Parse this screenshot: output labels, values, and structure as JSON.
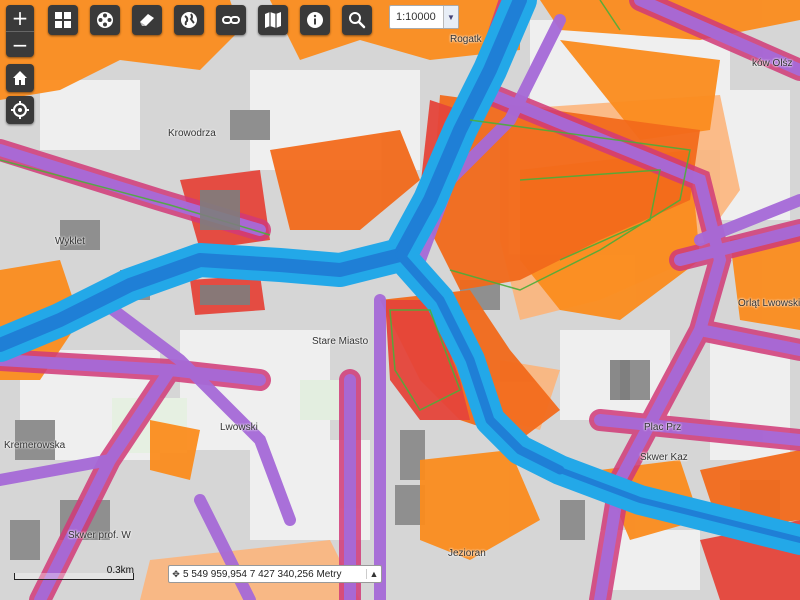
{
  "toolbar": {
    "zoom_in": "+",
    "zoom_out": "−",
    "buttons": [
      {
        "name": "layers-grid-icon"
      },
      {
        "name": "film-reel-icon"
      },
      {
        "name": "eraser-icon"
      },
      {
        "name": "globe-icon"
      },
      {
        "name": "link-icon"
      },
      {
        "name": "map-icon"
      },
      {
        "name": "info-icon"
      },
      {
        "name": "search-icon"
      }
    ],
    "side_buttons": [
      {
        "name": "home-icon"
      },
      {
        "name": "locate-icon"
      }
    ]
  },
  "scale_select": {
    "value": "1:10000"
  },
  "scale_bar": {
    "label": "0.3km"
  },
  "coordinates": {
    "text": "5 549 959,954 7 427 340,256 Metry"
  },
  "map_labels": {
    "krowodrza": "Krowodrza",
    "stare_miasto": "Stare Miasto",
    "rogatki": "Rogatk",
    "krakow_olsz": "ków Olśz",
    "wyklet": "Wyklet",
    "plac_prz": "Plac Prz",
    "skwer_kaz": "Skwer Kaz",
    "skwer_prof": "Skwer prof. W",
    "jezioran": "Jezioran",
    "orlat_lwowskich": "Orląt Lwowskich",
    "kremerowska": "Kremerowska",
    "lwowski": "Lwowski"
  },
  "legend_colors": {
    "water": "#1f7fd6",
    "water_light": "#23a8e8",
    "violet": "#a66ad8",
    "magenta": "#d13a78",
    "red": "#e5443a",
    "orange_red": "#f26a1b",
    "orange": "#fb8c1e",
    "light_orange": "#fcb57c",
    "building": "#8f8f8f",
    "base": "#d6d6d6"
  }
}
